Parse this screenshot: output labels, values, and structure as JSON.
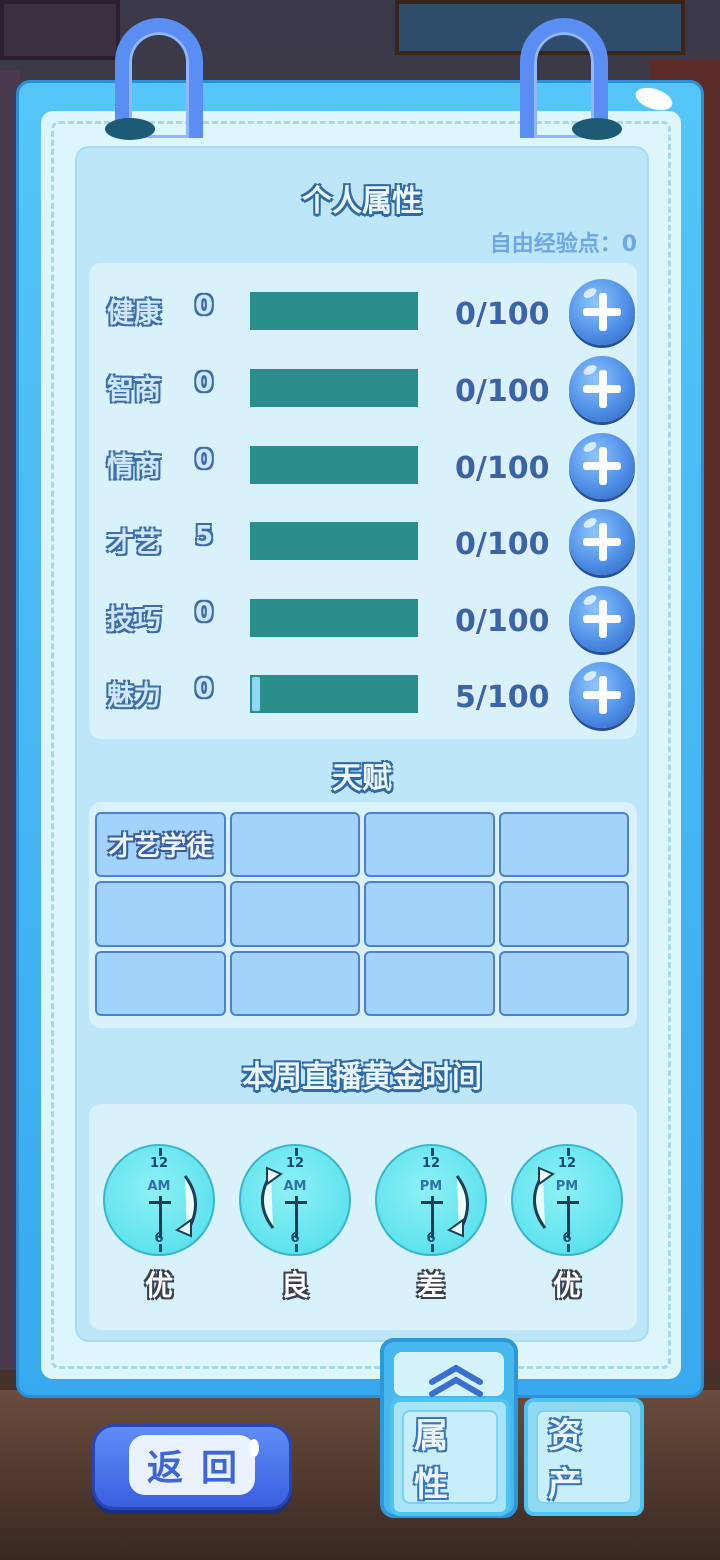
{
  "header": {
    "title": "个人属性",
    "free_exp_label": "自由经验点：0"
  },
  "attributes": [
    {
      "name": "健康",
      "level": "0",
      "progress": "0/100",
      "fill_fraction": 0.0
    },
    {
      "name": "智商",
      "level": "0",
      "progress": "0/100",
      "fill_fraction": 0.0
    },
    {
      "name": "情商",
      "level": "0",
      "progress": "0/100",
      "fill_fraction": 0.0
    },
    {
      "name": "才艺",
      "level": "5",
      "progress": "0/100",
      "fill_fraction": 0.0
    },
    {
      "name": "技巧",
      "level": "0",
      "progress": "0/100",
      "fill_fraction": 0.0
    },
    {
      "name": "魅力",
      "level": "0",
      "progress": "5/100",
      "fill_fraction": 0.05
    }
  ],
  "talent": {
    "title": "天赋",
    "slots": [
      "才艺学徒",
      "",
      "",
      "",
      "",
      "",
      "",
      "",
      "",
      "",
      "",
      ""
    ]
  },
  "golden_time": {
    "title": "本周直播黄金时间",
    "clocks": [
      {
        "period": "AM",
        "top": "12",
        "bottom": "6",
        "quality": "优",
        "arrow": "right"
      },
      {
        "period": "AM",
        "top": "12",
        "bottom": "6",
        "quality": "良",
        "arrow": "left"
      },
      {
        "period": "PM",
        "top": "12",
        "bottom": "6",
        "quality": "差",
        "arrow": "right"
      },
      {
        "period": "PM",
        "top": "12",
        "bottom": "6",
        "quality": "优",
        "arrow": "left"
      }
    ]
  },
  "tabs": {
    "attributes_label": "属性",
    "assets_label": "资产"
  },
  "back_button": {
    "label": "返回"
  },
  "icons": {
    "plus": "plus-icon",
    "collapse": "double-chevron-up-icon"
  },
  "colors": {
    "panel": "#38a9ee",
    "bar": "#2a8f8c",
    "clock": "#5fe3ee",
    "button": "#4f8fe6"
  }
}
